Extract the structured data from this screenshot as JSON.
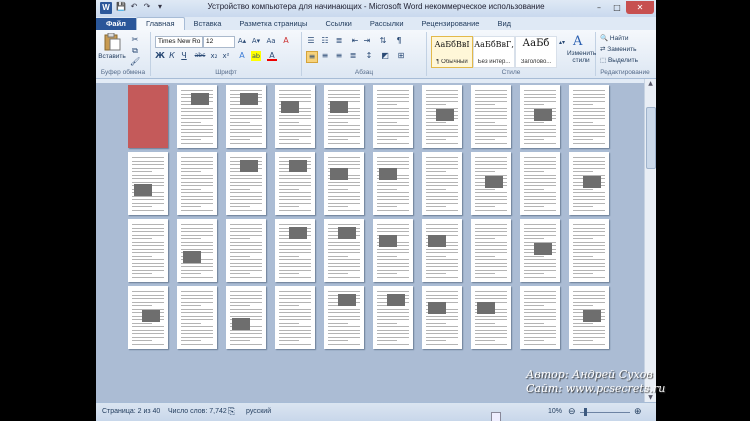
{
  "window": {
    "title": "Устройство компьютера для начинающих - Microsoft Word некоммерческое использование",
    "app_icon": "W",
    "controls": [
      "–",
      "□",
      "✕"
    ]
  },
  "quick_access": [
    "💾",
    "↶",
    "↷",
    "▾"
  ],
  "tabs": [
    "Файл",
    "Главная",
    "Вставка",
    "Разметка страницы",
    "Ссылки",
    "Рассылки",
    "Рецензирование",
    "Вид"
  ],
  "ribbon": {
    "clipboard": {
      "label": "Буфер обмена",
      "paste": "Вставить"
    },
    "font": {
      "label": "Шрифт",
      "name": "Times New Ro",
      "size": "12",
      "bold": "Ж",
      "italic": "К",
      "underline": "Ч",
      "strike": "abc",
      "sub": "x₂",
      "sup": "x²",
      "grow": "A▴",
      "shrink": "A▾",
      "case": "Aa",
      "clear": "A",
      "color": "A",
      "highlight": "ab"
    },
    "paragraph": {
      "label": "Абзац",
      "pilcrow": "¶"
    },
    "styles": {
      "label": "Стиле",
      "items": [
        {
          "sample": "АаБбВвІ",
          "name": "¶ Обычный"
        },
        {
          "sample": "АаБбВвГ,",
          "name": "Без интер..."
        },
        {
          "sample": "АаБб",
          "name": "Заголово..."
        }
      ],
      "change": "Изменить стили"
    },
    "editing": {
      "label": "Редактирование",
      "find": "Найти",
      "replace": "Заменить",
      "select": "Выделить"
    }
  },
  "status": {
    "page": "Страница: 2 из 40",
    "words": "Число слов: 7,742",
    "language": "русский",
    "zoom": "10%"
  },
  "watermark": {
    "author": "Автор: Андрей Сухов",
    "site": "Сайт: www.pcsecrets.ru"
  },
  "document": {
    "page_count": 40,
    "columns": 10,
    "rows": 4
  }
}
